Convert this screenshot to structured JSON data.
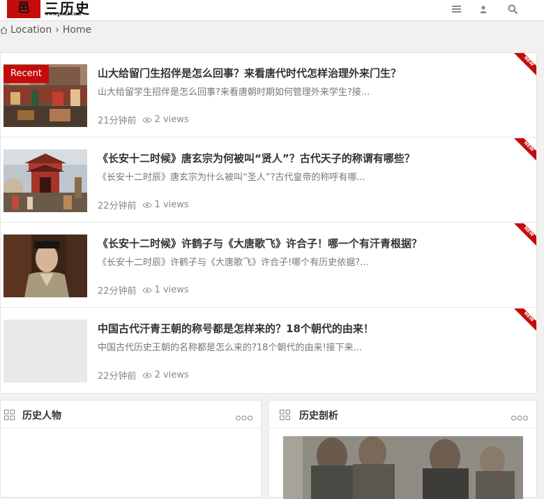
{
  "header": {
    "logo_badge": "邑",
    "logo_text": "三历史",
    "logo_url": "www.pou2.com",
    "icons": [
      "menu-icon",
      "user-icon",
      "search-icon"
    ]
  },
  "breadcrumb": {
    "location_label": "Location",
    "separator": "›",
    "home_label": "Home"
  },
  "posts": [
    {
      "badge": "Recent",
      "title": "山大给留门生招伴是怎么回事？来看唐代时代怎样治理外来门生？",
      "excerpt": "山大给留学生招伴是怎么回事?来看唐朝时期如何管理外来学生?接...",
      "time": "21分钟前",
      "views": "2 views",
      "ribbon": "NEW"
    },
    {
      "title": "《长安十二时候》唐玄宗为何被叫“贤人”？古代天子的称谓有哪些？",
      "excerpt": "《长安十二时辰》唐玄宗为什么被叫“圣人”?古代皇帝的称呼有哪...",
      "time": "22分钟前",
      "views": "1 views",
      "ribbon": "NEW"
    },
    {
      "title": "《长安十二时候》许鹤子与《大唐歌飞》许合子！哪一个有汗青根据？",
      "excerpt": "《长安十二时辰》许鹤子与《大唐歌飞》许合子!哪个有历史依据?...",
      "time": "22分钟前",
      "views": "1 views",
      "ribbon": "NEW"
    },
    {
      "title": "中国古代汗青王朝的称号都是怎样来的？18个朝代的由来！",
      "excerpt": "中国古代历史王朝的名称都是怎么来的?18个朝代的由来!接下来...",
      "time": "22分钟前",
      "views": "2 views",
      "ribbon": "NEW"
    }
  ],
  "widgets": [
    {
      "title": "历史人物",
      "more": "ooo"
    },
    {
      "title": "历史剖析",
      "more": "ooo"
    }
  ],
  "colors": {
    "accent": "#c40c0c",
    "background": "#f1f1f1",
    "card": "#ffffff"
  }
}
